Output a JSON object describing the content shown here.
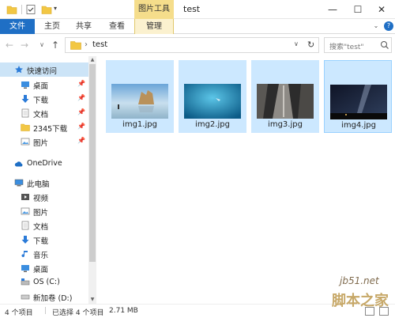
{
  "window": {
    "title": "test",
    "contextual_tab_group": "图片工具"
  },
  "ribbon": {
    "tabs": [
      "文件",
      "主页",
      "共享",
      "查看",
      "管理"
    ]
  },
  "address": {
    "path": "test",
    "search_placeholder": "搜索\"test\""
  },
  "nav": {
    "quick_access": "快速访问",
    "quick_items": [
      "桌面",
      "下载",
      "文档",
      "2345下载",
      "图片"
    ],
    "onedrive": "OneDrive",
    "this_pc": "此电脑",
    "pc_items": [
      "视频",
      "图片",
      "文档",
      "下载",
      "音乐",
      "桌面",
      "OS (C:)",
      "新加卷 (D:)"
    ]
  },
  "files": [
    {
      "name": "img1.jpg"
    },
    {
      "name": "img2.jpg"
    },
    {
      "name": "img3.jpg"
    },
    {
      "name": "img4.jpg"
    }
  ],
  "status": {
    "item_count": "4 个项目",
    "selected": "已选择 4 个项目",
    "size": "2.71 MB"
  },
  "watermark": {
    "line1": "jb51.net",
    "line2": "脚本之家"
  },
  "colors": {
    "accent": "#1f6fc5",
    "selection": "#cce8ff",
    "contextual": "#f5dd8b"
  }
}
